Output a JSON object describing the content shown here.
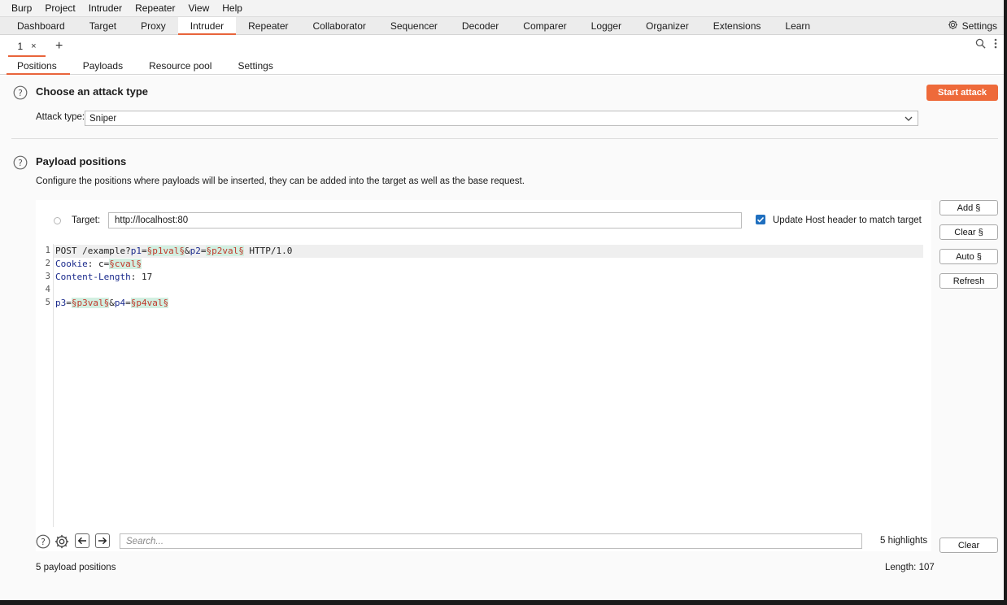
{
  "menu": [
    "Burp",
    "Project",
    "Intruder",
    "Repeater",
    "View",
    "Help"
  ],
  "tool_tabs": [
    "Dashboard",
    "Target",
    "Proxy",
    "Intruder",
    "Repeater",
    "Collaborator",
    "Sequencer",
    "Decoder",
    "Comparer",
    "Logger",
    "Organizer",
    "Extensions",
    "Learn"
  ],
  "active_tool_tab": "Intruder",
  "settings_label": "Settings",
  "request_tab": {
    "label": "1",
    "close": "×",
    "add": "+"
  },
  "sub_tabs": [
    "Positions",
    "Payloads",
    "Resource pool",
    "Settings"
  ],
  "active_sub_tab": "Positions",
  "attack_section": {
    "title": "Choose an attack type",
    "start_button": "Start attack",
    "attack_type_label": "Attack type:",
    "attack_type_value": "Sniper"
  },
  "positions_section": {
    "title": "Payload positions",
    "description": "Configure the positions where payloads will be inserted, they can be added into the target as well as the base request.",
    "target_label": "Target:",
    "target_value": "http://localhost:80",
    "update_host_label": "Update Host header to match target",
    "update_host_checked": true
  },
  "request_lines": [
    {
      "num": "1",
      "parts": [
        {
          "t": "POST /example?",
          "c": "k-dark"
        },
        {
          "t": "p1",
          "c": "k-blue"
        },
        {
          "t": "=",
          "c": "k-dark"
        },
        {
          "t": "§p1val§",
          "c": "hl"
        },
        {
          "t": "&",
          "c": "k-dark"
        },
        {
          "t": "p2",
          "c": "k-blue"
        },
        {
          "t": "=",
          "c": "k-dark"
        },
        {
          "t": "§p2val§",
          "c": "hl"
        },
        {
          "t": " HTTP/1.0",
          "c": "k-dark"
        }
      ]
    },
    {
      "num": "2",
      "parts": [
        {
          "t": "Cookie",
          "c": "k-blue"
        },
        {
          "t": ": c=",
          "c": "k-dark"
        },
        {
          "t": "§cval§",
          "c": "hl"
        }
      ]
    },
    {
      "num": "3",
      "parts": [
        {
          "t": "Content-Length",
          "c": "k-blue"
        },
        {
          "t": ": 17",
          "c": "k-dark"
        }
      ]
    },
    {
      "num": "4",
      "parts": []
    },
    {
      "num": "5",
      "parts": [
        {
          "t": "p3",
          "c": "k-blue"
        },
        {
          "t": "=",
          "c": "k-dark"
        },
        {
          "t": "§p3val§",
          "c": "hl"
        },
        {
          "t": "&",
          "c": "k-dark"
        },
        {
          "t": "p4",
          "c": "k-blue"
        },
        {
          "t": "=",
          "c": "k-dark"
        },
        {
          "t": "§p4val§",
          "c": "hl"
        }
      ]
    }
  ],
  "side_buttons": {
    "add": "Add §",
    "clear": "Clear §",
    "auto": "Auto §",
    "refresh": "Refresh",
    "clear_bottom": "Clear"
  },
  "search": {
    "placeholder": "Search..."
  },
  "highlights": "5 highlights",
  "status": {
    "positions": "5 payload positions",
    "length": "Length: 107"
  },
  "colors": {
    "accent": "#ee6a3a",
    "checkbox": "#1f6fbf",
    "highlight_bg": "#d2efe1",
    "keyword": "#1a2a8c"
  }
}
